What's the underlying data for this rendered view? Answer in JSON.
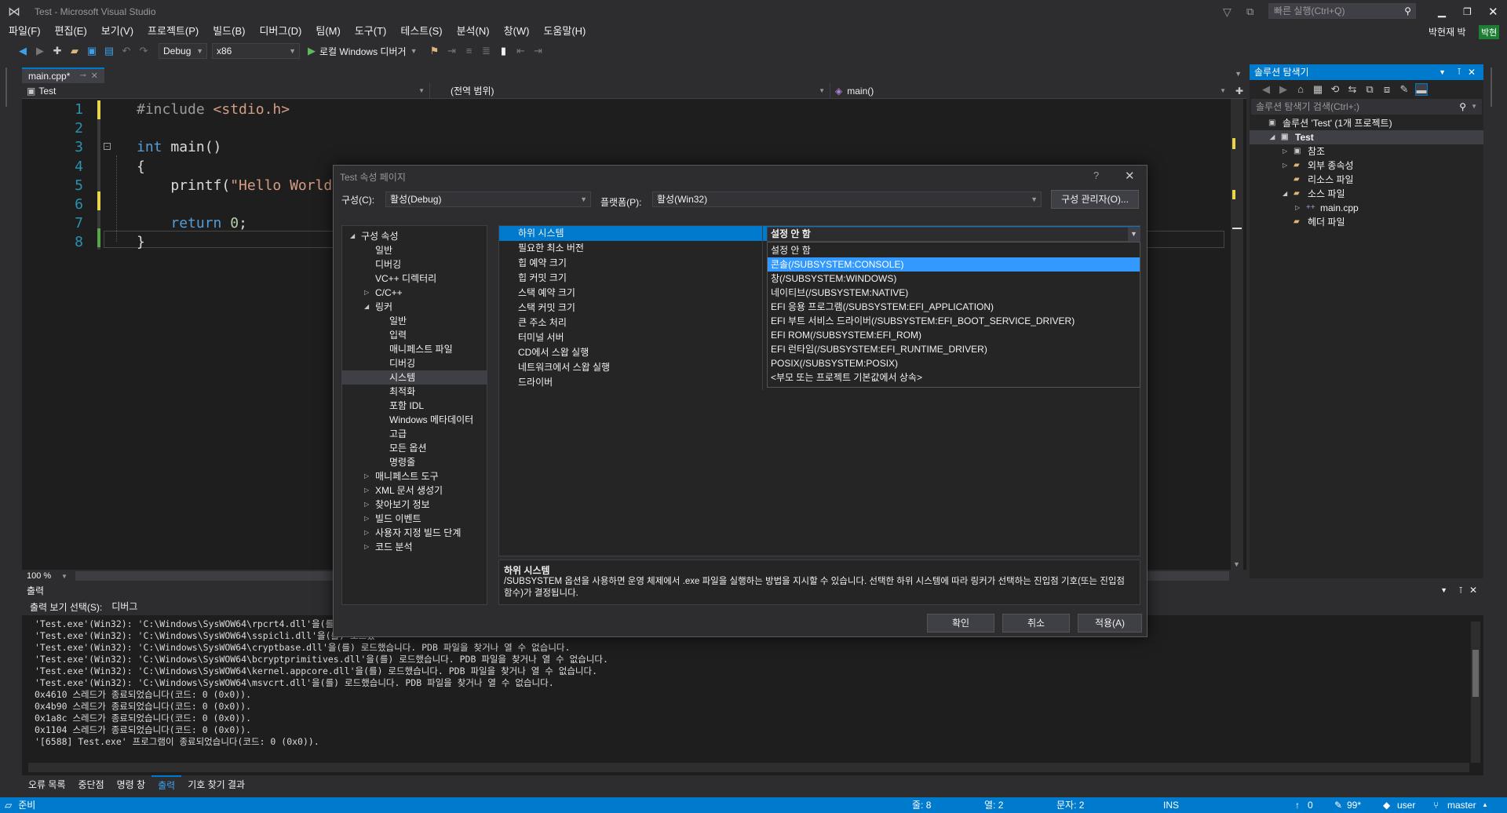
{
  "window": {
    "title": "Test - Microsoft Visual Studio",
    "quick_launch": "빠른 실행(Ctrl+Q)",
    "user": "박현재 박",
    "user_badge": "박현"
  },
  "menu": [
    "파일(F)",
    "편집(E)",
    "보기(V)",
    "프로젝트(P)",
    "빌드(B)",
    "디버그(D)",
    "팀(M)",
    "도구(T)",
    "테스트(S)",
    "분석(N)",
    "창(W)",
    "도움말(H)"
  ],
  "toolbar": {
    "config": "Debug",
    "platform": "x86",
    "run_label": "로컬 Windows 디버거"
  },
  "editor": {
    "tab": "main.cpp*",
    "nav_project": "Test",
    "nav_scope": "(전역 범위)",
    "nav_func": "main()",
    "zoom": "100 %",
    "lines": [
      {
        "n": "1",
        "parts": [
          {
            "c": "inc",
            "t": "#include "
          },
          {
            "c": "str",
            "t": "<stdio.h>"
          }
        ]
      },
      {
        "n": "2",
        "parts": []
      },
      {
        "n": "3",
        "parts": [
          {
            "c": "kw",
            "t": "int"
          },
          {
            "c": "id",
            "t": " main()"
          }
        ]
      },
      {
        "n": "4",
        "parts": [
          {
            "c": "id",
            "t": "{"
          }
        ]
      },
      {
        "n": "5",
        "parts": [
          {
            "c": "id",
            "t": "    printf("
          },
          {
            "c": "str",
            "t": "\"Hello World!\\n"
          }
        ]
      },
      {
        "n": "6",
        "parts": []
      },
      {
        "n": "7",
        "parts": [
          {
            "c": "id",
            "t": "    "
          },
          {
            "c": "kw",
            "t": "return"
          },
          {
            "c": "num",
            "t": " 0"
          },
          {
            "c": "id",
            "t": ";"
          }
        ]
      },
      {
        "n": "8",
        "parts": [
          {
            "c": "id",
            "t": "}"
          }
        ]
      }
    ]
  },
  "solution_explorer": {
    "title": "솔루션 탐색기",
    "search": "솔루션 탐색기 검색(Ctrl+;)",
    "items": [
      {
        "label": "솔루션 'Test' (1개 프로젝트)",
        "indent": 0,
        "exp": ""
      },
      {
        "label": "Test",
        "indent": 1,
        "exp": "◢",
        "bold": true
      },
      {
        "label": "참조",
        "indent": 2,
        "exp": "▷"
      },
      {
        "label": "외부 종속성",
        "indent": 2,
        "exp": "▷"
      },
      {
        "label": "리소스 파일",
        "indent": 2,
        "exp": ""
      },
      {
        "label": "소스 파일",
        "indent": 2,
        "exp": "◢"
      },
      {
        "label": "main.cpp",
        "indent": 3,
        "exp": "▷"
      },
      {
        "label": "헤더 파일",
        "indent": 2,
        "exp": ""
      }
    ]
  },
  "output": {
    "title": "출력",
    "source_label": "출력 보기 선택(S):",
    "source_value": "디버그",
    "lines": [
      "'Test.exe'(Win32): 'C:\\Windows\\SysWOW64\\rpcrt4.dll'을(를) 로드했",
      "'Test.exe'(Win32): 'C:\\Windows\\SysWOW64\\sspicli.dll'을(를) 로드했",
      "'Test.exe'(Win32): 'C:\\Windows\\SysWOW64\\cryptbase.dll'을(를) 로드했습니다. PDB 파일을 찾거나 열 수 없습니다.",
      "'Test.exe'(Win32): 'C:\\Windows\\SysWOW64\\bcryptprimitives.dll'을(를) 로드했습니다. PDB 파일을 찾거나 열 수 없습니다.",
      "'Test.exe'(Win32): 'C:\\Windows\\SysWOW64\\kernel.appcore.dll'을(를) 로드했습니다. PDB 파일을 찾거나 열 수 없습니다.",
      "'Test.exe'(Win32): 'C:\\Windows\\SysWOW64\\msvcrt.dll'을(를) 로드했습니다. PDB 파일을 찾거나 열 수 없습니다.",
      "0x4610 스레드가 종료되었습니다(코드: 0 (0x0)).",
      "0x4b90 스레드가 종료되었습니다(코드: 0 (0x0)).",
      "0x1a8c 스레드가 종료되었습니다(코드: 0 (0x0)).",
      "0x1104 스레드가 종료되었습니다(코드: 0 (0x0)).",
      "'[6588] Test.exe' 프로그램이 종료되었습니다(코드: 0 (0x0))."
    ],
    "tabs": [
      "오류 목록",
      "중단점",
      "명령 창",
      "출력",
      "기호 찾기 결과"
    ]
  },
  "status": {
    "ready": "준비",
    "line": "줄: 8",
    "col": "열: 2",
    "char": "문자: 2",
    "ins": "INS",
    "up": "0",
    "edits": "99*",
    "user": "user",
    "branch": "master"
  },
  "dialog": {
    "title": "Test 속성 페이지",
    "config_label": "구성(C):",
    "config_value": "활성(Debug)",
    "platform_label": "플랫폼(P):",
    "platform_value": "활성(Win32)",
    "config_manager": "구성 관리자(O)...",
    "tree": [
      {
        "label": "구성 속성",
        "indent": 0,
        "exp": "◢"
      },
      {
        "label": "일반",
        "indent": 1
      },
      {
        "label": "디버깅",
        "indent": 1
      },
      {
        "label": "VC++ 디렉터리",
        "indent": 1
      },
      {
        "label": "C/C++",
        "indent": 1,
        "exp": "▷"
      },
      {
        "label": "링커",
        "indent": 1,
        "exp": "◢"
      },
      {
        "label": "일반",
        "indent": 2
      },
      {
        "label": "입력",
        "indent": 2
      },
      {
        "label": "매니페스트 파일",
        "indent": 2
      },
      {
        "label": "디버깅",
        "indent": 2
      },
      {
        "label": "시스템",
        "indent": 2,
        "selected": true
      },
      {
        "label": "최적화",
        "indent": 2
      },
      {
        "label": "포함 IDL",
        "indent": 2
      },
      {
        "label": "Windows 메타데이터",
        "indent": 2
      },
      {
        "label": "고급",
        "indent": 2
      },
      {
        "label": "모든 옵션",
        "indent": 2
      },
      {
        "label": "명령줄",
        "indent": 2
      },
      {
        "label": "매니페스트 도구",
        "indent": 1,
        "exp": "▷"
      },
      {
        "label": "XML 문서 생성기",
        "indent": 1,
        "exp": "▷"
      },
      {
        "label": "찾아보기 정보",
        "indent": 1,
        "exp": "▷"
      },
      {
        "label": "빌드 이벤트",
        "indent": 1,
        "exp": "▷"
      },
      {
        "label": "사용자 지정 빌드 단계",
        "indent": 1,
        "exp": "▷"
      },
      {
        "label": "코드 분석",
        "indent": 1,
        "exp": "▷"
      }
    ],
    "props": [
      "하위 시스템",
      "필요한 최소 버전",
      "힙 예약 크기",
      "힙 커밋 크기",
      "스택 예약 크기",
      "스택 커밋 크기",
      "큰 주소 처리",
      "터미널 서버",
      "CD에서 스왑 실행",
      "네트워크에서 스왑 실행",
      "드라이버"
    ],
    "selected_value": "설정 안 함",
    "options": [
      "설정 안 함",
      "콘솔(/SUBSYSTEM:CONSOLE)",
      "창(/SUBSYSTEM:WINDOWS)",
      "네이티브(/SUBSYSTEM:NATIVE)",
      "EFI 응용 프로그램(/SUBSYSTEM:EFI_APPLICATION)",
      "EFI 부트 서비스 드라이버(/SUBSYSTEM:EFI_BOOT_SERVICE_DRIVER)",
      "EFI ROM(/SUBSYSTEM:EFI_ROM)",
      "EFI 런타임(/SUBSYSTEM:EFI_RUNTIME_DRIVER)",
      "POSIX(/SUBSYSTEM:POSIX)",
      "<부모 또는 프로젝트 기본값에서 상속>"
    ],
    "highlighted_option": 1,
    "desc_title": "하위 시스템",
    "desc_text": "/SUBSYSTEM 옵션을 사용하면 운영 체제에서 .exe 파일을 실행하는 방법을 지시할 수 있습니다. 선택한 하위 시스템에 따라 링커가 선택하는 진입점 기호(또는 진입점 함수)가 결정됩니다.",
    "ok": "확인",
    "cancel": "취소",
    "apply": "적용(A)"
  },
  "colors": {
    "accent": "#007acc",
    "selection": "#3399ff",
    "background": "#2d2d30"
  }
}
